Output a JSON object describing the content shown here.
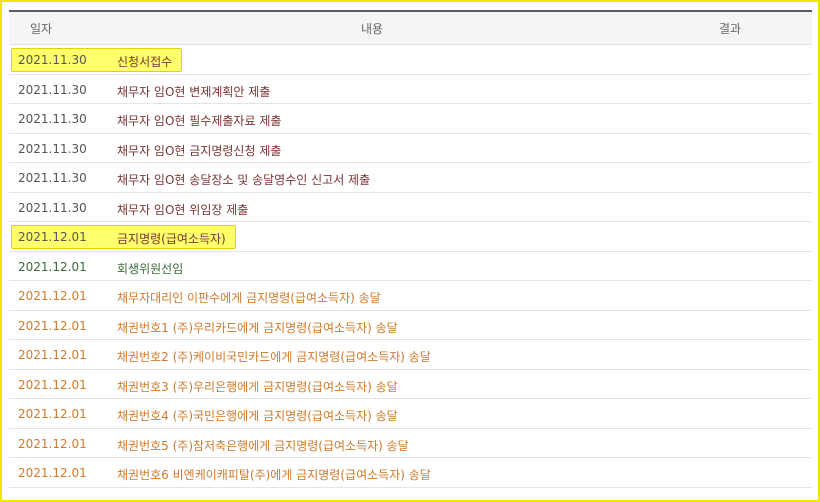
{
  "header": {
    "date": "일자",
    "content": "내용",
    "result": "결과"
  },
  "rows": [
    {
      "date": "2021.11.30",
      "text": "신청서접수",
      "tone": "dark",
      "highlight": true
    },
    {
      "date": "2021.11.30",
      "text": "채무자 임O현 변제계획안 제출",
      "tone": "dark",
      "highlight": false
    },
    {
      "date": "2021.11.30",
      "text": "채무자 임O현 필수제출자료 제출",
      "tone": "dark",
      "highlight": false
    },
    {
      "date": "2021.11.30",
      "text": "채무자 임O현 금지명령신청 제출",
      "tone": "dark",
      "highlight": false
    },
    {
      "date": "2021.11.30",
      "text": "채무자 임O현 송달장소 및 송달영수인 신고서 제출",
      "tone": "dark",
      "highlight": false
    },
    {
      "date": "2021.11.30",
      "text": "채무자 임O현 위임장 제출",
      "tone": "dark",
      "highlight": false
    },
    {
      "date": "2021.12.01",
      "text": "금지명령(급여소득자)",
      "tone": "dark",
      "highlight": true
    },
    {
      "date": "2021.12.01",
      "text": "회생위원선임",
      "tone": "green",
      "highlight": false
    },
    {
      "date": "2021.12.01",
      "text": "채무자대리인 이판수에게 금지명령(급여소득자) 송달",
      "tone": "orange",
      "highlight": false
    },
    {
      "date": "2021.12.01",
      "text": "채권번호1 (주)우리카드에게 금지명령(급여소득자) 송달",
      "tone": "orange",
      "highlight": false
    },
    {
      "date": "2021.12.01",
      "text": "채권번호2 (주)케이비국민카드에게 금지명령(급여소득자) 송달",
      "tone": "orange",
      "highlight": false
    },
    {
      "date": "2021.12.01",
      "text": "채권번호3 (주)우리은행에게 금지명령(급여소득자) 송달",
      "tone": "orange",
      "highlight": false
    },
    {
      "date": "2021.12.01",
      "text": "채권번호4 (주)국민은행에게 금지명령(급여소득자) 송달",
      "tone": "orange",
      "highlight": false
    },
    {
      "date": "2021.12.01",
      "text": "채권번호5 (주)참저축은행에게 금지명령(급여소득자) 송달",
      "tone": "orange",
      "highlight": false
    },
    {
      "date": "2021.12.01",
      "text": "채권번호6 비엔케이캐피탈(주)에게 금지명령(급여소득자) 송달",
      "tone": "orange",
      "highlight": false
    }
  ],
  "colors": {
    "header_border": "#5d5d5d",
    "highlight": "#ffff6b",
    "frame": "#f2e600"
  }
}
